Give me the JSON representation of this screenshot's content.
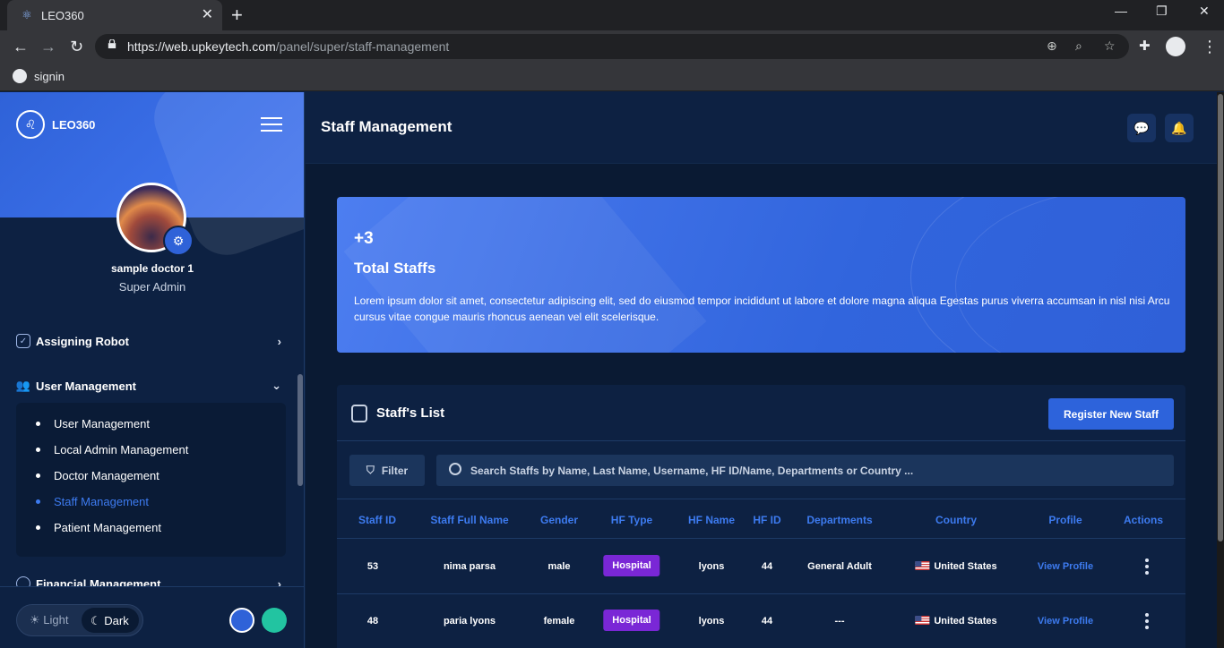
{
  "browser": {
    "tab_title": "LEO360",
    "url_host": "https://web.upkeytech.com",
    "url_path": "/panel/super/staff-management",
    "bookmark": "signin"
  },
  "sidebar": {
    "brand": "LEO360",
    "user_name": "sample doctor 1",
    "user_role": "Super Admin",
    "menu": [
      {
        "label": "Assigning Robot"
      },
      {
        "label": "User Management"
      },
      {
        "label": "Financial Management"
      }
    ],
    "submenu": [
      {
        "label": "User Management"
      },
      {
        "label": "Local Admin Management"
      },
      {
        "label": "Doctor Management"
      },
      {
        "label": "Staff Management"
      },
      {
        "label": "Patient Management"
      }
    ],
    "theme": {
      "light": "Light",
      "dark": "Dark"
    },
    "swatch_colors": [
      "#2f62d8",
      "#22c4a1"
    ]
  },
  "header": {
    "title": "Staff Management"
  },
  "banner": {
    "count": "+3",
    "title": "Total Staffs",
    "description": "Lorem ipsum dolor sit amet, consectetur adipiscing elit, sed do eiusmod tempor incididunt ut labore et dolore magna aliqua Egestas purus viverra accumsan in nisl nisi Arcu cursus vitae congue mauris rhoncus aenean vel elit scelerisque."
  },
  "list": {
    "title": "Staff's List",
    "register_label": "Register New Staff",
    "filter_label": "Filter",
    "search_placeholder": "Search Staffs by Name, Last Name, Username, HF ID/Name, Departments or Country ...",
    "columns": [
      "Staff ID",
      "Staff Full Name",
      "Gender",
      "HF Type",
      "HF Name",
      "HF ID",
      "Departments",
      "Country",
      "Profile",
      "Actions"
    ],
    "rows": [
      {
        "id": "53",
        "name": "nima parsa",
        "gender": "male",
        "hf_type": "Hospital",
        "hf_name": "lyons",
        "hf_id": "44",
        "department": "General Adult",
        "country": "United States",
        "profile": "View Profile"
      },
      {
        "id": "48",
        "name": "paria lyons",
        "gender": "female",
        "hf_type": "Hospital",
        "hf_name": "lyons",
        "hf_id": "44",
        "department": "---",
        "country": "United States",
        "profile": "View Profile"
      }
    ]
  },
  "colors": {
    "accent": "#2f62d8",
    "pill": "#7a27d6",
    "link": "#3d7bf0"
  }
}
